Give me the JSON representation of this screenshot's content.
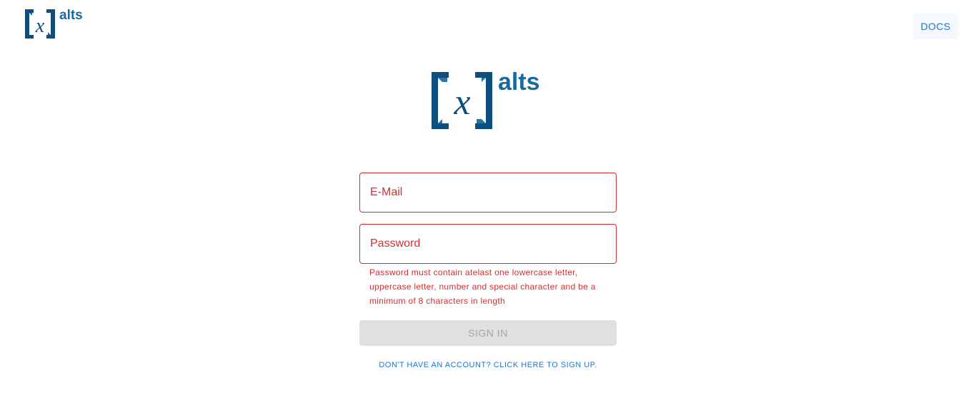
{
  "header": {
    "logo_text": "alts",
    "logo_symbol": "x",
    "docs_label": "DOCS"
  },
  "hero": {
    "logo_text": "alts",
    "logo_symbol": "x"
  },
  "form": {
    "email": {
      "placeholder": "E-Mail",
      "value": ""
    },
    "password": {
      "placeholder": "Password",
      "value": ""
    },
    "password_error": "Password must contain atelast one lowercase letter, uppercase letter, number and special character and be a minimum of 8 characters in length",
    "signin_label": "SIGN IN",
    "signin_enabled": false,
    "signup_link": "DON'T HAVE AN ACCOUNT? CLICK HERE TO SIGN UP."
  },
  "colors": {
    "brand": "#0d4f7e",
    "accent": "#1976d2",
    "error": "#d32f2f",
    "disabled_bg": "#e0e0e0",
    "disabled_text": "#a6a6a6"
  }
}
